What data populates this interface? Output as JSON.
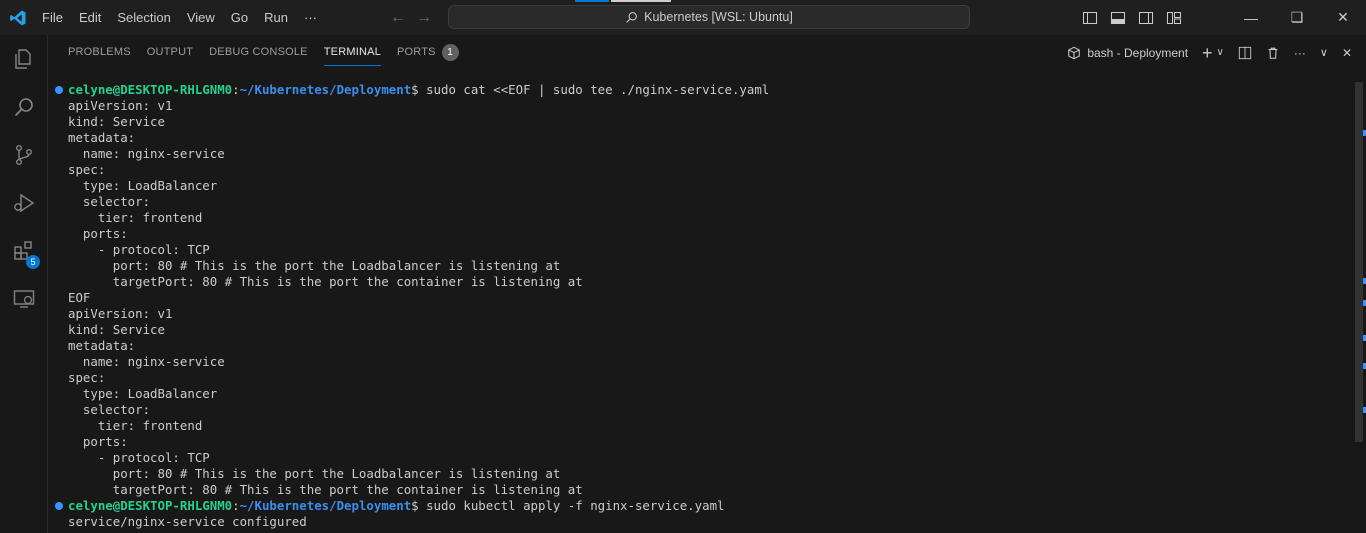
{
  "titlebar": {
    "menu": [
      "File",
      "Edit",
      "Selection",
      "View",
      "Go",
      "Run",
      "···"
    ],
    "search_text": "Kubernetes [WSL: Ubuntu]"
  },
  "activity": {
    "extensions_badge": "5"
  },
  "panel": {
    "tabs": [
      {
        "label": "PROBLEMS"
      },
      {
        "label": "OUTPUT"
      },
      {
        "label": "DEBUG CONSOLE"
      },
      {
        "label": "TERMINAL"
      },
      {
        "label": "PORTS"
      }
    ],
    "ports_count": "1",
    "terminal_name": "bash - Deployment"
  },
  "terminal": {
    "prompt_user": "celyne@DESKTOP-RHLGNM0",
    "prompt_path": "~/Kubernetes/Deployment",
    "cmd1": "sudo cat <<EOF | sudo tee ./nginx-service.yaml",
    "cmd2": "sudo kubectl apply -f nginx-service.yaml",
    "lines1": [
      "apiVersion: v1",
      "kind: Service",
      "metadata:",
      "  name: nginx-service",
      "spec:",
      "  type: LoadBalancer",
      "  selector:",
      "    tier: frontend",
      "  ports:",
      "    - protocol: TCP",
      "      port: 80 # This is the port the Loadbalancer is listening at",
      "      targetPort: 80 # This is the port the container is listening at",
      "EOF",
      "apiVersion: v1",
      "kind: Service",
      "metadata:",
      "  name: nginx-service",
      "spec:",
      "  type: LoadBalancer",
      "  selector:",
      "    tier: frontend",
      "  ports:",
      "    - protocol: TCP",
      "      port: 80 # This is the port the Loadbalancer is listening at",
      "      targetPort: 80 # This is the port the container is listening at"
    ],
    "output2": "service/nginx-service configured"
  },
  "colors": {
    "accent": "#0078d4",
    "prompt_user": "#23d18b",
    "prompt_path": "#3b8eea"
  }
}
